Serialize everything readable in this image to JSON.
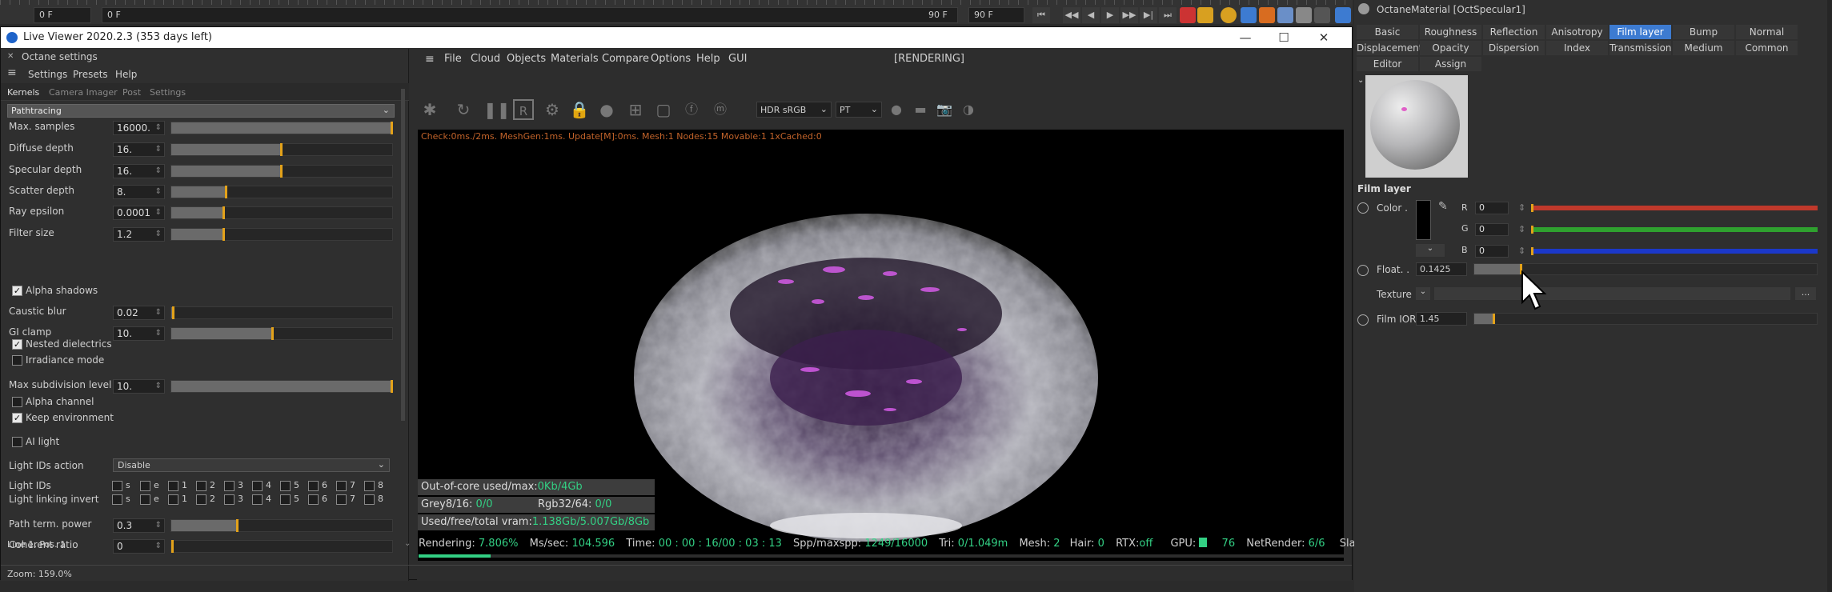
{
  "timeline": {
    "start_field": "0 F",
    "current_field": "0 F",
    "end_label": "90 F",
    "end_field": "90 F"
  },
  "window": {
    "title": "Live Viewer 2020.2.3 (353 days left)",
    "minimize": "—",
    "maximize": "☐",
    "close": "✕"
  },
  "left_panel": {
    "header": "Octane settings",
    "menu": [
      "Settings",
      "Presets",
      "Help"
    ],
    "tabs": [
      "Kernels",
      "Camera Imager",
      "Post",
      "Settings"
    ],
    "kernel_select": "Pathtracing",
    "params": [
      {
        "label": "Max. samples",
        "value": "16000.",
        "level": 1.0
      },
      {
        "label": "Diffuse depth",
        "value": "16.",
        "level": 0.5
      },
      {
        "label": "Specular depth",
        "value": "16.",
        "level": 0.5
      },
      {
        "label": "Scatter depth",
        "value": "8.",
        "level": 0.25
      },
      {
        "label": "Ray epsilon",
        "value": "0.0001",
        "level": 0.24
      },
      {
        "label": "Filter size",
        "value": "1.2",
        "level": 0.24
      }
    ],
    "alpha_shadows": "Alpha shadows",
    "caustic_blur": {
      "label": "Caustic blur",
      "value": "0.02",
      "level": 0.01
    },
    "gi_clamp": {
      "label": "GI clamp",
      "value": "10.",
      "level": 0.46
    },
    "nested": "Nested dielectrics",
    "irradiance": "Irradiance mode",
    "max_subdiv": {
      "label": "Max subdivision level",
      "value": "10.",
      "level": 1.0
    },
    "alpha_channel": "Alpha channel",
    "keep_env": "Keep environment",
    "ai_light": "AI light",
    "light_ids_action": {
      "label": "Light IDs action",
      "value": "Disable"
    },
    "light_ids_label": "Light IDs",
    "light_linking_label": "Light linking invert",
    "light_id_items": [
      "s",
      "e",
      "1",
      "2",
      "3",
      "4",
      "5",
      "6",
      "7",
      "8"
    ],
    "path_term": {
      "label": "Path term. power",
      "value": "0.3",
      "level": 0.3
    },
    "coherent": {
      "label": "Coherent ratio",
      "value": "0",
      "level": 0.0
    },
    "status_line": "Line 1, Pos. 1",
    "zoom": "Zoom: 159.0%"
  },
  "center": {
    "menu": [
      "File",
      "Cloud",
      "Objects",
      "Materials",
      "Compare",
      "Options",
      "Help",
      "GUI"
    ],
    "render_status": "[RENDERING]",
    "color_space": "HDR sRGB",
    "kernel_short": "PT",
    "viewport_info": "Check:0ms./2ms. MeshGen:1ms. Update[M]:0ms. Mesh:1 Nodes:15 Movable:1 1xCached:0",
    "out_of_core_label": "Out-of-core used/max:",
    "out_of_core_value": "0Kb/4Gb",
    "grey_label": "Grey8/16:",
    "grey_value": "0/0",
    "rgb_label": "Rgb32/64:",
    "rgb_value": "0/0",
    "vram_label": "Used/free/total vram:",
    "vram_value": "1.138Gb/5.007Gb/8Gb",
    "stats": {
      "rendering_label": "Rendering:",
      "rendering_value": "7.806%",
      "mss_label": "Ms/sec:",
      "mss_value": "104.596",
      "time_label": "Time:",
      "time_value": "00 : 00 : 16/00 : 03 : 13",
      "spp_label": "Spp/maxspp:",
      "spp_value": "1249/16000",
      "tri_label": "Tri:",
      "tri_value": "0/1.049m",
      "mesh_label": "Mesh:",
      "mesh_value": "2",
      "hair_label": "Hair:",
      "hair_value": "0",
      "rtx_label": "RTX:",
      "rtx_value": "off",
      "gpu_label": "GPU:",
      "gpu_value": "76",
      "net_label": "NetRender:",
      "net_value": "6/6",
      "slaves_label": "Slaves:"
    },
    "progress": 0.078
  },
  "right_panel": {
    "material_title": "OctaneMaterial [OctSpecular1]",
    "tabs_row1": [
      "Basic",
      "Roughness",
      "Reflection",
      "Anisotropy",
      "Film layer",
      "Bump",
      "Normal"
    ],
    "tabs_row2": [
      "Displacement",
      "Opacity",
      "Dispersion",
      "Index",
      "Transmission",
      "Medium",
      "Common"
    ],
    "tabs_row3": [
      "Editor",
      "Assign"
    ],
    "active_tab": "Film layer",
    "section": "Film layer",
    "color_label": "Color .",
    "r_label": "R",
    "g_label": "G",
    "b_label": "B",
    "r_value": "0",
    "g_value": "0",
    "b_value": "0",
    "float_label": "Float. .",
    "float_value": "0.1425",
    "float_level": 0.14,
    "texture_label": "Texture",
    "texture_more": "...",
    "film_ior_label": "Film IOR",
    "film_ior_value": "1.45",
    "film_ior_level": 0.06,
    "colors": {
      "r_bar": "#c0392b",
      "g_bar": "#2fa12f",
      "b_bar": "#1b38c9",
      "accent": "#e3a21a",
      "active_tab": "#3d7bd1"
    }
  }
}
